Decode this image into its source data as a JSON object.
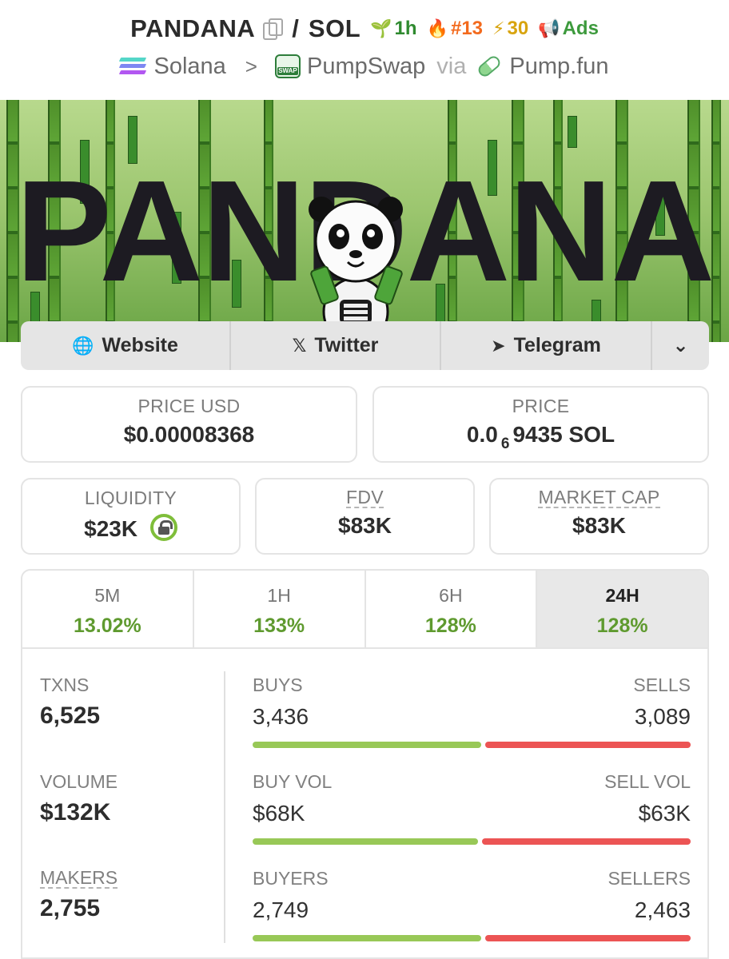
{
  "header": {
    "base_token": "PANDANA",
    "quote_token": "SOL",
    "separator": "/",
    "badges": {
      "age": "1h",
      "trending_rank": "#13",
      "boosts": "30",
      "ads": "Ads"
    },
    "chain": "Solana",
    "dex": "PumpSwap",
    "via_label": "via",
    "launchpad": "Pump.fun"
  },
  "banner": {
    "word": "PANDANA",
    "icon": "panda-mascot"
  },
  "social": {
    "website": "Website",
    "twitter": "Twitter",
    "telegram": "Telegram",
    "more_icon": "chevron-down-icon"
  },
  "stats": {
    "price_usd_label": "PRICE USD",
    "price_usd": "$0.00008368",
    "price_label": "PRICE",
    "price_prefix": "0.0",
    "price_zero_count": "6",
    "price_suffix": "9435 SOL",
    "liquidity_label": "LIQUIDITY",
    "liquidity": "$23K",
    "fdv_label": "FDV",
    "fdv": "$83K",
    "mcap_label": "MARKET CAP",
    "mcap": "$83K"
  },
  "timeframes": [
    {
      "label": "5M",
      "change": "13.02%"
    },
    {
      "label": "1H",
      "change": "133%"
    },
    {
      "label": "6H",
      "change": "128%"
    },
    {
      "label": "24H",
      "change": "128%"
    }
  ],
  "active_timeframe": "24H",
  "txn": {
    "txns_label": "TXNS",
    "txns": "6,525",
    "volume_label": "VOLUME",
    "volume": "$132K",
    "makers_label": "MAKERS",
    "makers": "2,755",
    "buys_label": "BUYS",
    "buys": "3,436",
    "sells_label": "SELLS",
    "sells": "3,089",
    "buy_vol_label": "BUY VOL",
    "buy_vol": "$68K",
    "sell_vol_label": "SELL VOL",
    "sell_vol": "$63K",
    "buyers_label": "BUYERS",
    "buyers": "2,749",
    "sellers_label": "SELLERS",
    "sellers": "2,463",
    "buy_share_txns": 0.527,
    "buy_share_volume": 0.519,
    "buy_share_makers": 0.527
  },
  "colors": {
    "positive": "#5f9a2f",
    "buy_bar": "#98c857",
    "sell_bar": "#ec5454"
  }
}
